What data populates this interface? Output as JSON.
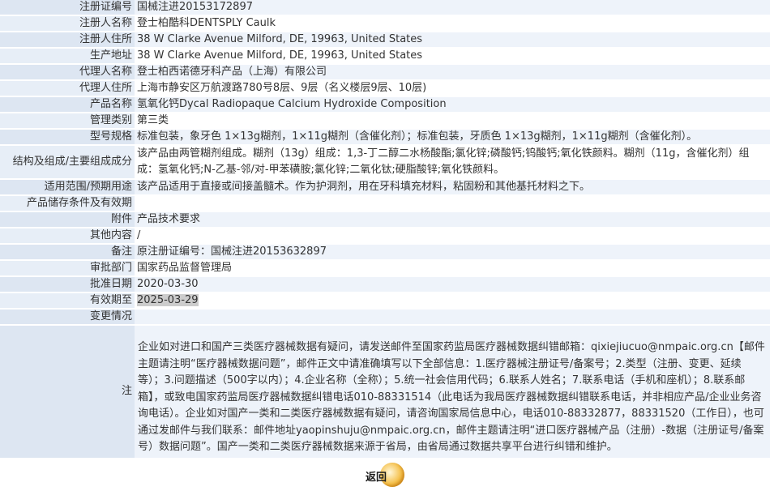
{
  "rows": [
    {
      "label": "注册证编号",
      "value": "国械注进20153172897"
    },
    {
      "label": "注册人名称",
      "value": "登士柏酷科DENTSPLY Caulk"
    },
    {
      "label": "注册人住所",
      "value": "38 W Clarke Avenue Milford, DE, 19963, United States"
    },
    {
      "label": "生产地址",
      "value": "38 W Clarke Avenue Milford, DE, 19963, United States"
    },
    {
      "label": "代理人名称",
      "value": "登士柏西诺德牙科产品（上海）有限公司"
    },
    {
      "label": "代理人住所",
      "value": "上海市静安区万航渡路780号8层、9层（名义楼层9层、10层)"
    },
    {
      "label": "产品名称",
      "value": "氢氧化钙Dycal Radiopaque Calcium Hydroxide Composition"
    },
    {
      "label": "管理类别",
      "value": "第三类"
    },
    {
      "label": "型号规格",
      "value": "标准包装，象牙色 1×13g糊剂，1×11g糊剂（含催化剂）；标准包装，牙质色 1×13g糊剂，1×11g糊剂（含催化剂）。"
    },
    {
      "label": "结构及组成/主要组成成分",
      "value": "该产品由两管糊剂组成。糊剂（13g）组成：1,3-丁二醇二水杨酸酯;氯化锌;磷酸钙;钨酸钙;氧化铁颜料。糊剂（11g，含催化剂）组成：氢氧化钙;N-乙基-邻/对-甲苯磺胺;氯化锌;二氧化钛;硬脂酸锌;氧化铁颜料。"
    },
    {
      "label": "适用范围/预期用途",
      "value": "该产品适用于直接或间接盖髓术。作为护洞剂，用在牙科填充材料，粘固粉和其他基托材料之下。"
    },
    {
      "label": "产品储存条件及有效期",
      "value": ""
    },
    {
      "label": "附件",
      "value": "产品技术要求"
    },
    {
      "label": "其他内容",
      "value": "/"
    },
    {
      "label": "备注",
      "value": "原注册证编号：国械注进20153632897"
    },
    {
      "label": "审批部门",
      "value": "国家药品监督管理局"
    },
    {
      "label": "批准日期",
      "value": "2020-03-30"
    },
    {
      "label": "有效期至",
      "value": "2025-03-29"
    },
    {
      "label": "变更情况",
      "value": ""
    }
  ],
  "note": {
    "label": "注",
    "text": "企业如对进口和国产三类医疗器械数据有疑问，请发送邮件至国家药监局医疗器械数据纠错邮箱：qixiejiucuo@nmpaic.org.cn【邮件主题请注明“医疗器械数据问题”，邮件正文中请准确填写以下全部信息：1.医疗器械注册证号/备案号；2.类型（注册、变更、延续等）；3.问题描述（500字以内）；4.企业名称（全称）；5.统一社会信用代码；6.联系人姓名；7.联系电话（手机和座机）；8.联系邮箱】，或致电国家药监局医疗器械数据纠错电话010-88331514（此电话为我局医疗器械数据纠错联系电话，并非相应产品/企业业务咨询电话）。企业如对国产一类和二类医疗器械数据有疑问，请咨询国家局信息中心，电话010-88332877，88331520（工作日），也可通过发邮件与我们联系：邮件地址yaopinshuju@nmpaic.org.cn，邮件主题请注明“进口医疗器械产品（注册）-数据（注册证号/备案号）数据问题”。国产一类和二类医疗器械数据来源于省局，由省局通过数据共享平台进行纠错和维护。"
  },
  "back_button": {
    "label": "返回",
    "icon": "circle-arrow-icon"
  }
}
